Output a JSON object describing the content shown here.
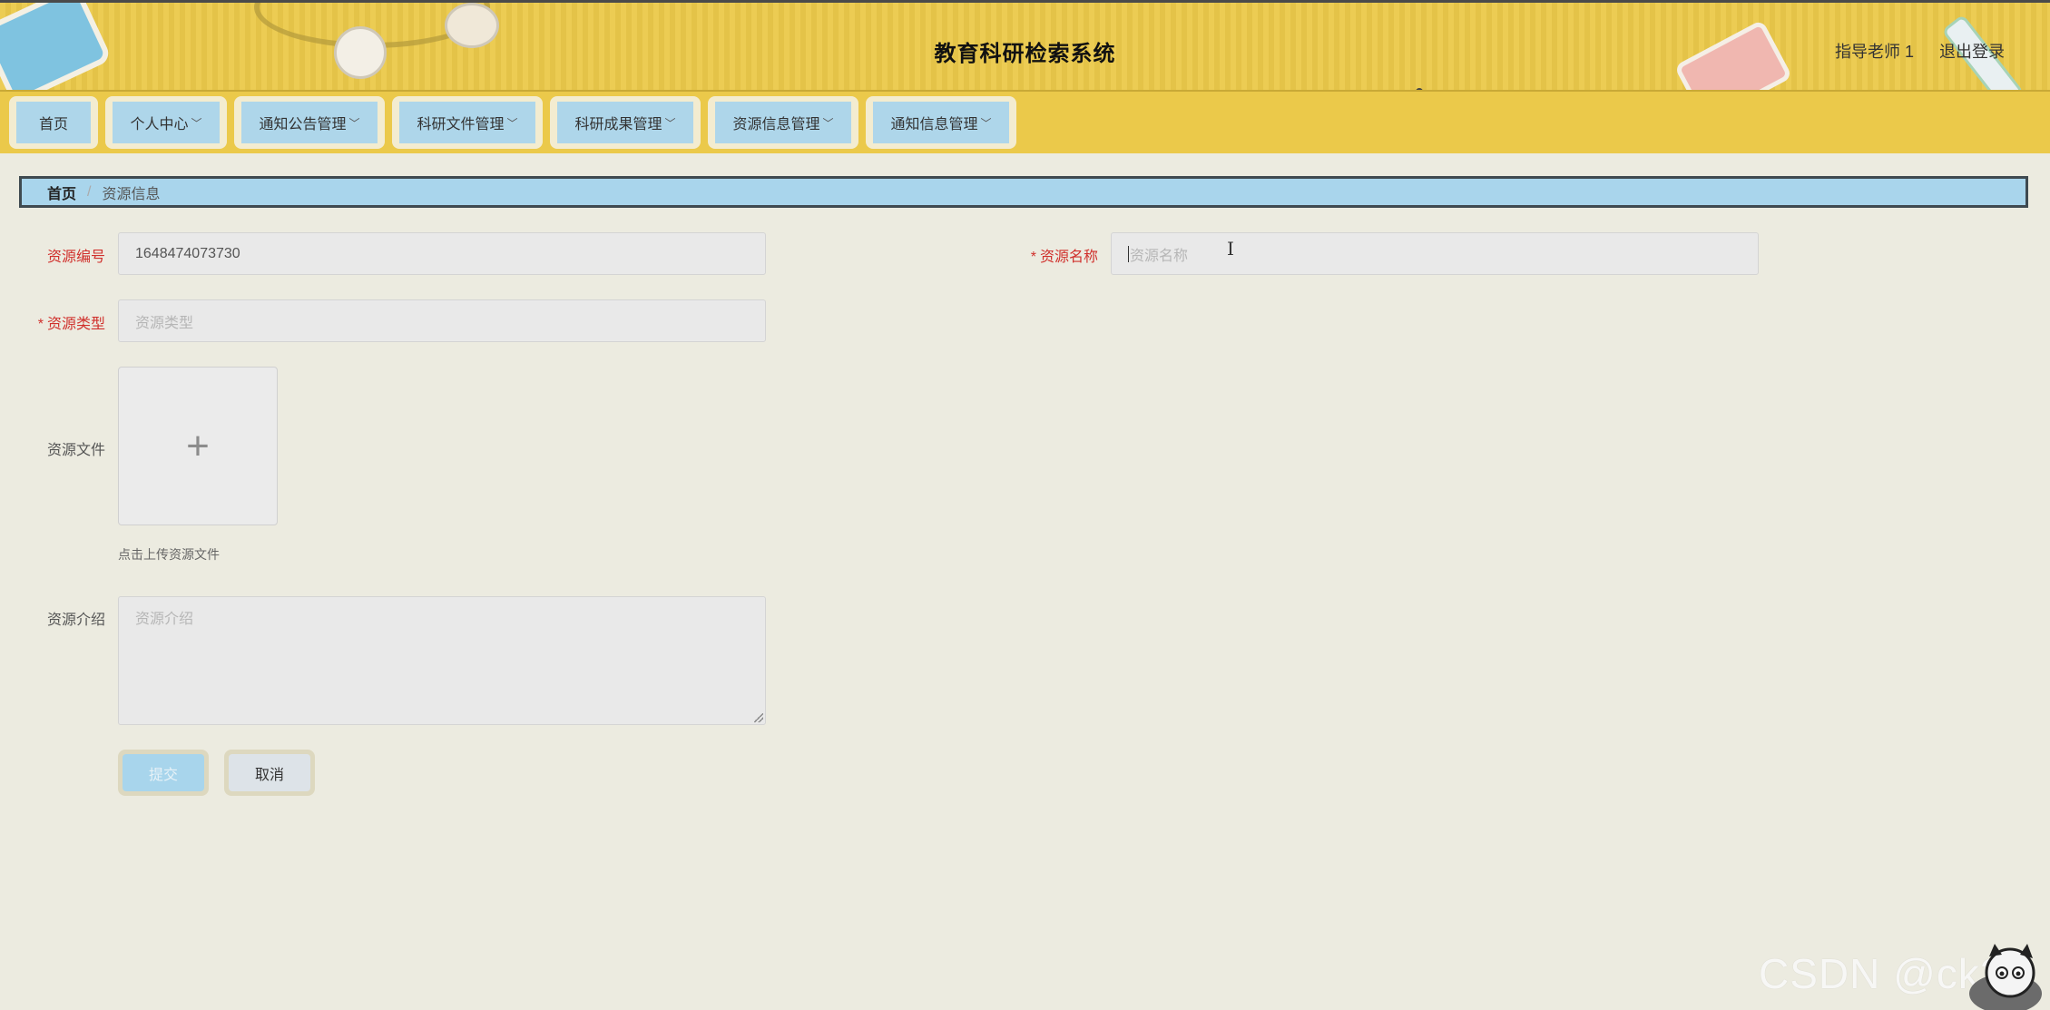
{
  "header": {
    "title": "教育科研检索系统",
    "user_name": "指导老师 1",
    "logout_label": "退出登录"
  },
  "nav": {
    "items": [
      {
        "label": "首页",
        "has_dropdown": false
      },
      {
        "label": "个人中心",
        "has_dropdown": true
      },
      {
        "label": "通知公告管理",
        "has_dropdown": true
      },
      {
        "label": "科研文件管理",
        "has_dropdown": true
      },
      {
        "label": "科研成果管理",
        "has_dropdown": true
      },
      {
        "label": "资源信息管理",
        "has_dropdown": true
      },
      {
        "label": "通知信息管理",
        "has_dropdown": true
      }
    ],
    "caret": "﹀"
  },
  "breadcrumb": {
    "home": "首页",
    "separator": "/",
    "current": "资源信息"
  },
  "form": {
    "resource_no": {
      "label": "资源编号",
      "value": "1648474073730"
    },
    "resource_name": {
      "label": "资源名称",
      "placeholder": "资源名称",
      "required_mark": "*"
    },
    "resource_type": {
      "label": "资源类型",
      "placeholder": "资源类型",
      "required_mark": "*"
    },
    "resource_file": {
      "label": "资源文件",
      "upload_icon": "+",
      "hint": "点击上传资源文件"
    },
    "resource_intro": {
      "label": "资源介绍",
      "placeholder": "资源介绍"
    },
    "submit_label": "提交",
    "cancel_label": "取消"
  },
  "watermark": "CSDN @ck30",
  "colors": {
    "header_bg": "#ebc94a",
    "nav_button_bg": "#aed6ea",
    "breadcrumb_bg": "#a9d5ec",
    "page_bg": "#ecebe0",
    "required_red": "#d0312d"
  }
}
